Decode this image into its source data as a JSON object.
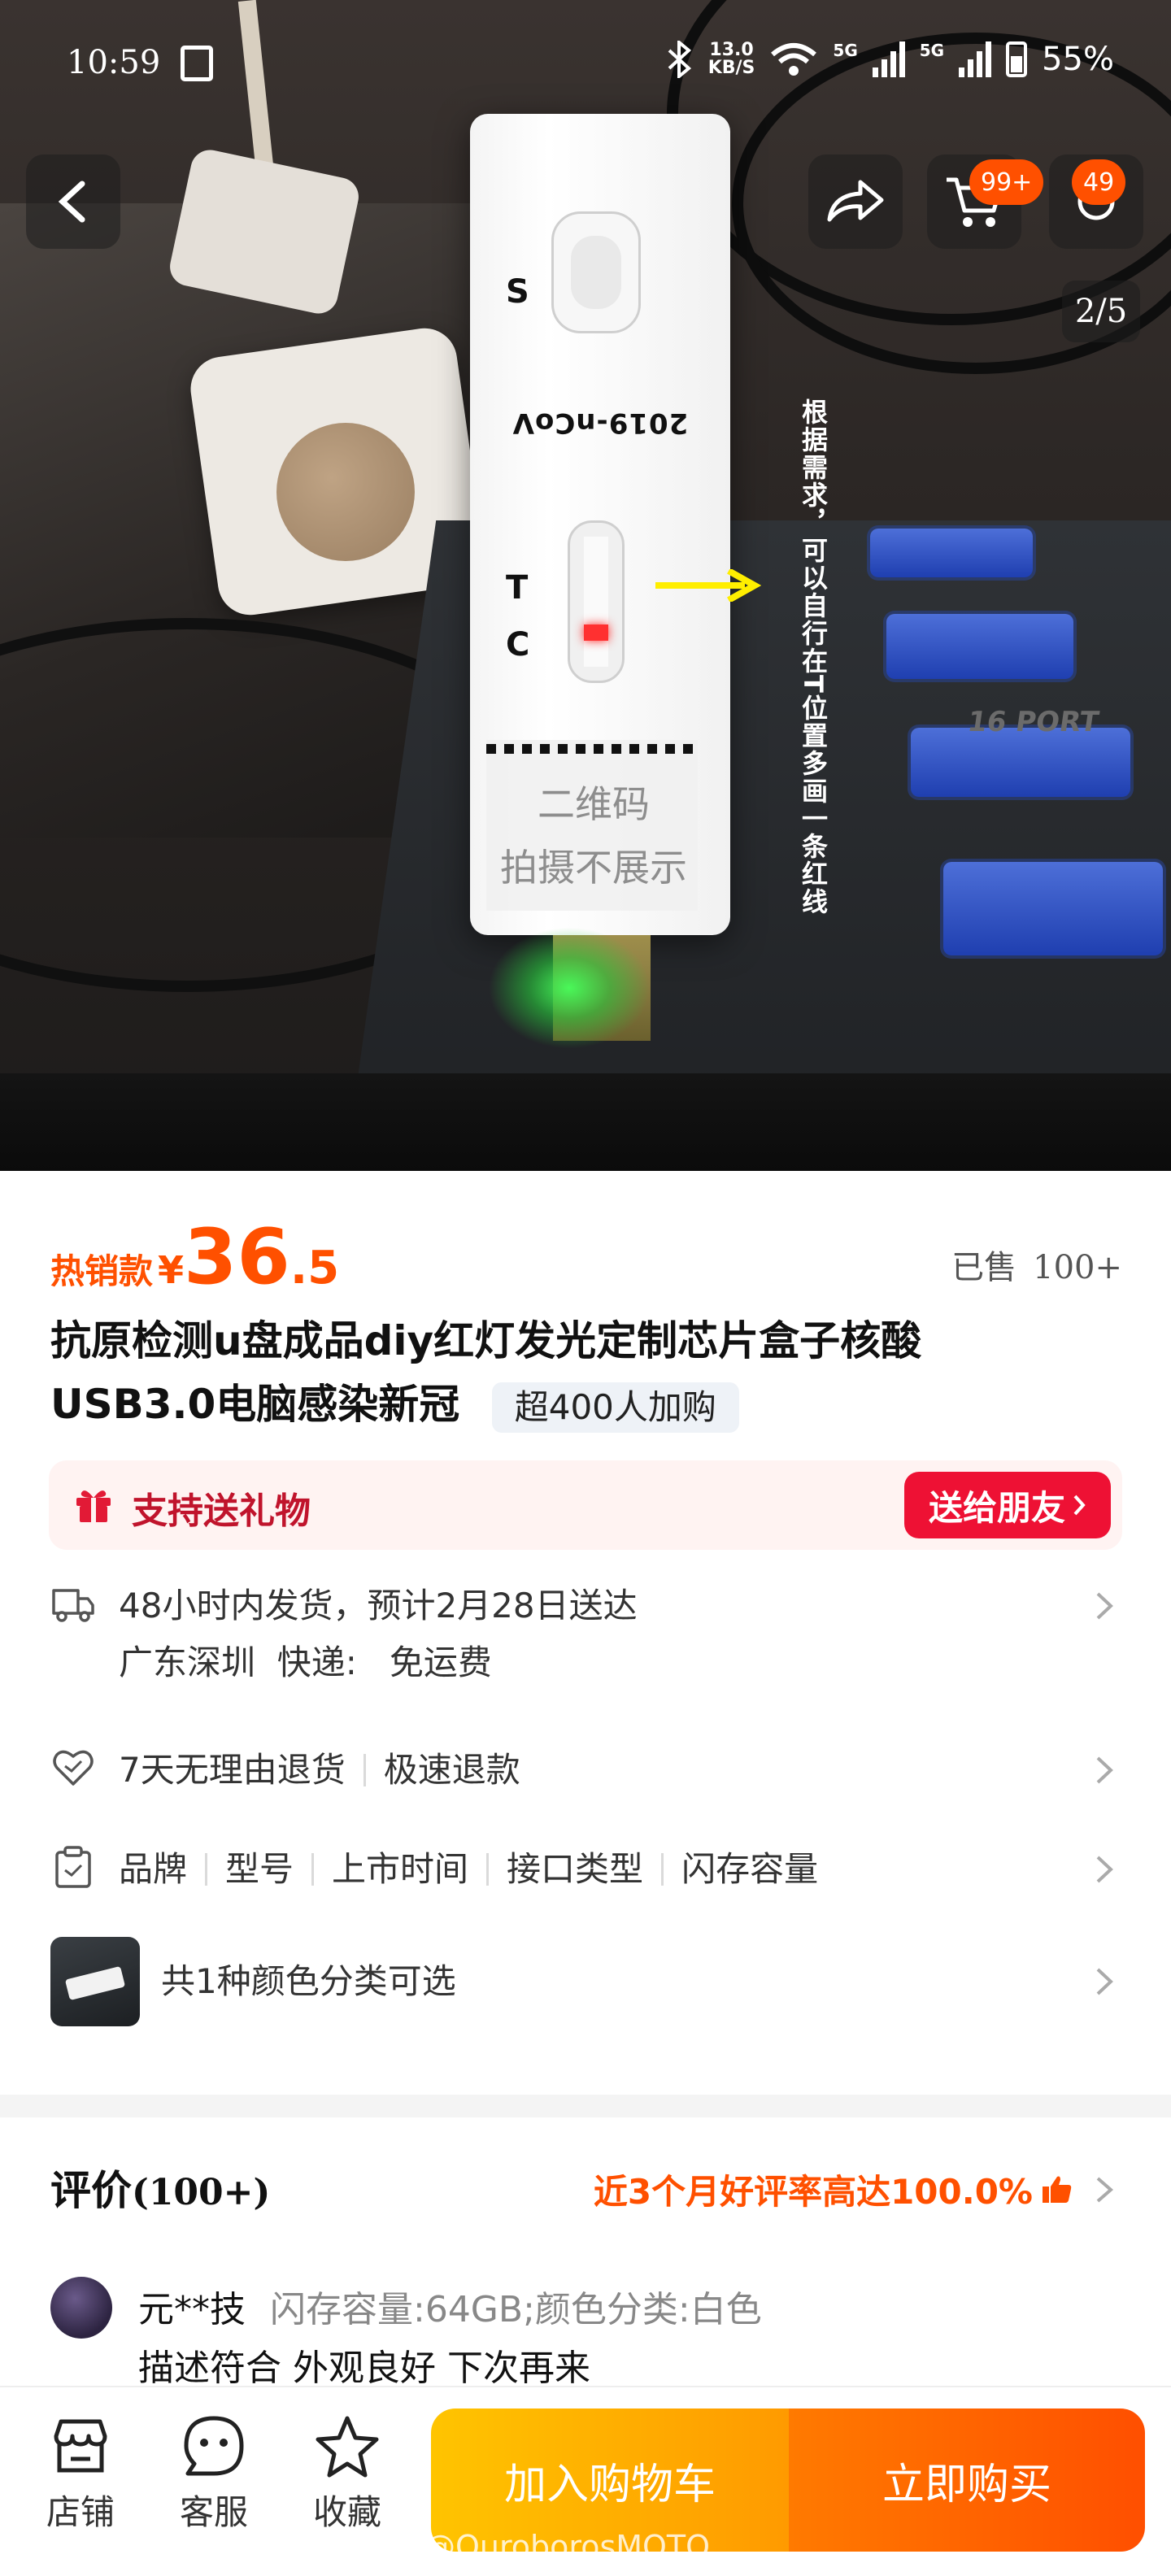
{
  "status_bar": {
    "time": "10:59",
    "network_speed_value": "13.0",
    "network_speed_unit": "KB/S",
    "sim1_label": "5G",
    "sim2_label": "5G",
    "battery": "55%"
  },
  "top_nav": {
    "back_icon": "chevron-left-icon",
    "share_icon": "share-arrow-icon",
    "cart_icon": "cart-icon",
    "cart_badge": "99+",
    "message_badge": "49",
    "image_pager": "2/5"
  },
  "hero_image": {
    "cassette_label_s": "S",
    "cassette_label_t": "T",
    "cassette_label_c": "C",
    "cassette_brand": "2019-nCoV",
    "qr_caption_line1": "二维码",
    "qr_caption_line2": "拍摄不展示",
    "annotation": "根据需求，可以自行在T位置多画一条红线",
    "hub_text": "16 PORT"
  },
  "product": {
    "price_tag": "热销款",
    "currency": "¥",
    "price_integer": "36",
    "price_decimal": ".5",
    "sold_label": "已售",
    "sold_count": "100+",
    "title_line1": "抗原检测u盘成品diy红灯发光定制芯片盒子核酸",
    "title_line2": "USB3.0电脑感染新冠",
    "cart_chip": "超400人加购",
    "gift_label": "支持送礼物",
    "gift_button": "送给朋友",
    "shipping_line1": "48小时内发货，预计2月28日送达",
    "shipping_line2": "广东深圳  快递:   免运费",
    "return_policy": "7天无理由退货",
    "refund_policy": "极速退款",
    "params": [
      "品牌",
      "型号",
      "上市时间",
      "接口类型",
      "闪存容量"
    ],
    "sku_text": "共1种颜色分类可选"
  },
  "reviews": {
    "title": "评价",
    "count": "(100+)",
    "rating_text": "近3个月好评率高达100.0%",
    "reviewer": "元**技",
    "spec": "闪存容量:64GB;颜色分类:白色",
    "comment": "描述符合 外观良好 下次再来"
  },
  "bottom_bar": {
    "store_label": "店铺",
    "service_label": "客服",
    "favorite_label": "收藏",
    "add_cart_label": "加入购物车",
    "buy_now_label": "立即购买",
    "watermark": "@OuroborosMOTO"
  },
  "colors": {
    "accent_orange": "#ff5000",
    "gift_red": "#ee1134",
    "cart_yellow": "#ffc400"
  }
}
